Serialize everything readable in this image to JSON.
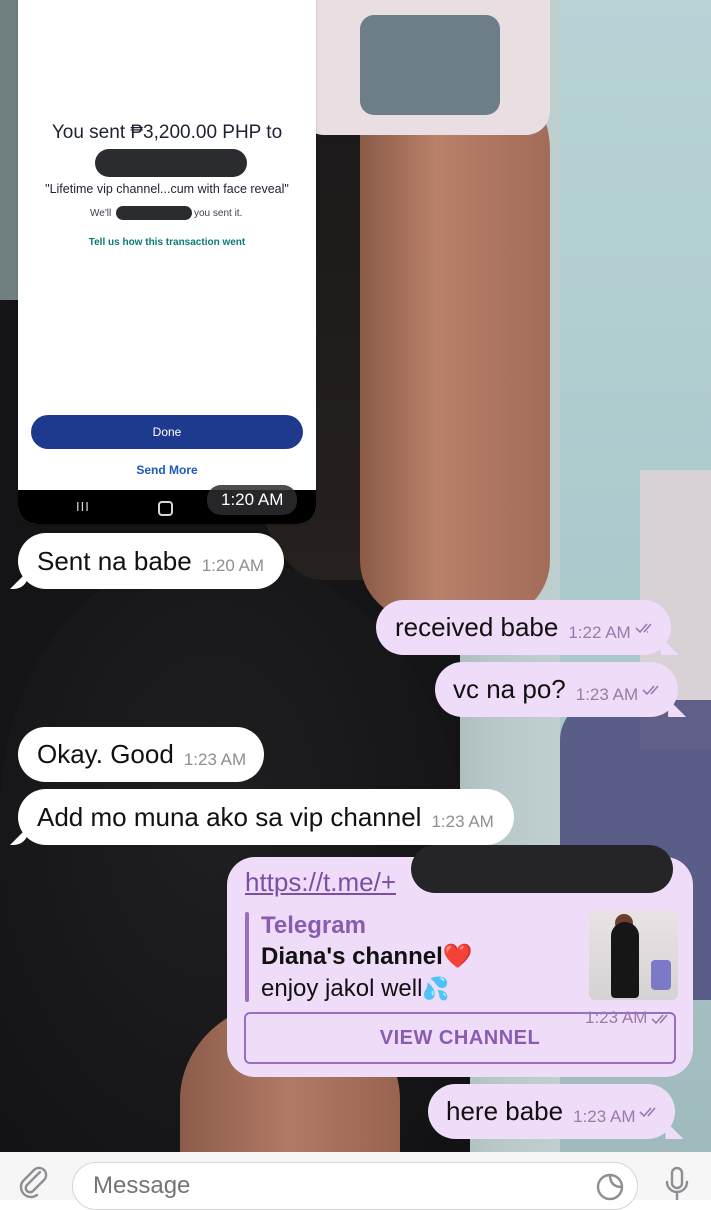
{
  "payment_screenshot": {
    "title": "You sent ₱3,200.00 PHP to",
    "note": "\"Lifetime vip channel...cum with face reveal\"",
    "we_prefix": "We'll",
    "we_suffix": "you sent it.",
    "feedback_link": "Tell us how this transaction went",
    "done_button": "Done",
    "send_more_button": "Send More",
    "nav_recents": "III",
    "time": "1:20 AM"
  },
  "messages": [
    {
      "direction": "incoming",
      "text": "Sent na babe",
      "time": "1:20 AM"
    },
    {
      "direction": "outgoing",
      "text": "received babe",
      "time": "1:22 AM"
    },
    {
      "direction": "outgoing",
      "text": "vc na po?",
      "time": "1:23 AM"
    },
    {
      "direction": "incoming",
      "text": "Okay. Good",
      "time": "1:23 AM"
    },
    {
      "direction": "incoming",
      "text": "Add mo muna ako sa vip channel",
      "time": "1:23 AM"
    },
    {
      "direction": "outgoing",
      "text": "here babe",
      "time": "1:23 AM"
    }
  ],
  "link_message": {
    "url": "https://t.me/+",
    "site_name": "Telegram",
    "title": "Diana's channel",
    "title_emoji": "❤️",
    "description": "enjoy jakol well",
    "description_emoji": "💦",
    "time": "1:23 AM",
    "button": "VIEW CHANNEL"
  },
  "input": {
    "placeholder": "Message"
  },
  "colors": {
    "outgoing_bubble": "#efdcf8",
    "incoming_bubble": "#ffffff",
    "accent": "#8a5cb1",
    "done_button": "#1d3a8f"
  },
  "icons": {
    "attach": "paperclip-icon",
    "sticker": "sticker-icon",
    "mic": "microphone-icon",
    "read": "double-check-icon"
  }
}
